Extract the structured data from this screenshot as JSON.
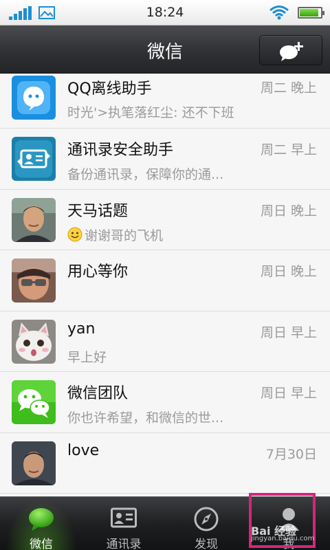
{
  "status_bar": {
    "time": "18:24",
    "icons": [
      "signal-icon",
      "photo-icon",
      "wifi-icon",
      "battery-icon"
    ],
    "battery_level": 0.9
  },
  "header": {
    "title": "微信",
    "compose_icon": "new-chat-icon"
  },
  "chats": [
    {
      "name": "QQ离线助手",
      "time": "周二 晚上",
      "preview": "时光'>执笔落红尘: 还不下班",
      "avatar": "qq-assistant-icon"
    },
    {
      "name": "通讯录安全助手",
      "time": "周二 早上",
      "preview": "备份通讯录，保障你的通...",
      "avatar": "contacts-security-icon"
    },
    {
      "name": "天马话题",
      "time": "周日 晚上",
      "preview": "谢谢哥的飞机",
      "avatar": "user-avatar",
      "emoji": "smile-emoji-icon"
    },
    {
      "name": "用心等你",
      "time": "周日 晚上",
      "preview": "",
      "avatar": "user-avatar"
    },
    {
      "name": "yan",
      "time": "周日 早上",
      "preview": "早上好",
      "avatar": "cat-avatar"
    },
    {
      "name": "微信团队",
      "time": "周日 早上",
      "preview": "你也许希望，和微信的世...",
      "avatar": "wechat-team-icon"
    },
    {
      "name": "love",
      "time": "7月30日",
      "preview": "",
      "avatar": "user-avatar"
    }
  ],
  "tabs": [
    {
      "label": "微信",
      "icon": "chat-bubble-icon",
      "active": true
    },
    {
      "label": "通讯录",
      "icon": "contacts-card-icon",
      "active": false
    },
    {
      "label": "发现",
      "icon": "compass-icon",
      "active": false
    },
    {
      "label": "我",
      "icon": "person-icon",
      "active": false
    }
  ],
  "watermark": {
    "text": "Bai 经验",
    "url": "jingyan.baidu.com"
  },
  "colors": {
    "accent": "#1d8fd1",
    "header": "#2f3134",
    "highlight": "#d6247b",
    "wechat_green": "#3ebd1c"
  }
}
